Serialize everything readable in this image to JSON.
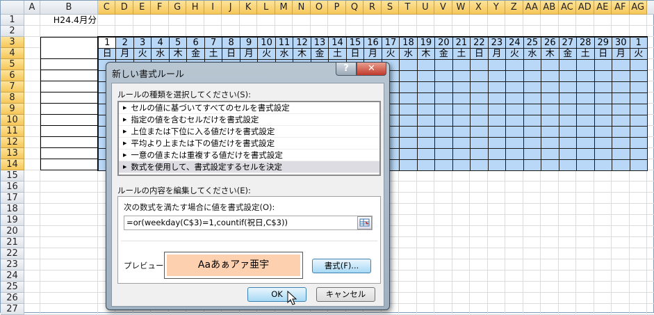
{
  "sheet": {
    "columns": [
      "A",
      "B",
      "C",
      "D",
      "E",
      "F",
      "G",
      "H",
      "I",
      "J",
      "K",
      "L",
      "M",
      "N",
      "O",
      "P",
      "Q",
      "R",
      "S",
      "T",
      "U",
      "V",
      "W",
      "X",
      "Y",
      "Z",
      "AA",
      "AB",
      "AC",
      "AD",
      "AE",
      "AF",
      "AG"
    ],
    "rows": [
      "1",
      "2",
      "3",
      "4",
      "5",
      "6",
      "7",
      "8",
      "9",
      "10",
      "11",
      "12",
      "13",
      "14",
      "15",
      "16",
      "17",
      "18",
      "19",
      "20",
      "21",
      "22",
      "23",
      "24",
      "25",
      "26",
      "27"
    ],
    "b1": "H24.4月分",
    "days": [
      "1",
      "2",
      "3",
      "4",
      "5",
      "6",
      "7",
      "8",
      "9",
      "10",
      "11",
      "12",
      "13",
      "14",
      "15",
      "16",
      "17",
      "18",
      "19",
      "20",
      "21",
      "22",
      "23",
      "24",
      "25",
      "26",
      "27",
      "28",
      "29",
      "30",
      "1"
    ],
    "weekdays": [
      "日",
      "月",
      "火",
      "水",
      "木",
      "金",
      "土",
      "日",
      "月",
      "火",
      "水",
      "木",
      "金",
      "土",
      "日",
      "月",
      "火",
      "水",
      "木",
      "金",
      "土",
      "日",
      "月",
      "火",
      "水",
      "木",
      "金",
      "土",
      "日",
      "月",
      "火"
    ],
    "fill_color": "#b9d8f7"
  },
  "dialog": {
    "title": "新しい書式ルール",
    "help_label": "?",
    "close_label": "✕",
    "rule_type_label": "ルールの種類を選択してください(S):",
    "rule_types": [
      "セルの値に基づいてすべてのセルを書式設定",
      "指定の値を含むセルだけを書式設定",
      "上位または下位に入る値だけを書式設定",
      "平均より上または下の値だけを書式設定",
      "一意の値または重複する値だけを書式設定",
      "数式を使用して、書式設定するセルを決定"
    ],
    "selected_rule_index": 5,
    "edit_label": "ルールの内容を編集してください(E):",
    "formula_label": "次の数式を満たす場合に値を書式設定(O):",
    "formula_value": "=or(weekday(C$3)=1,countif(祝日,C$3))",
    "preview_label": "プレビュー:",
    "preview_text": "Aaあぁアァ亜宇",
    "preview_color": "#fdd0b0",
    "format_button": "書式(F)...",
    "ok_button": "OK",
    "cancel_button": "キャンセル"
  }
}
